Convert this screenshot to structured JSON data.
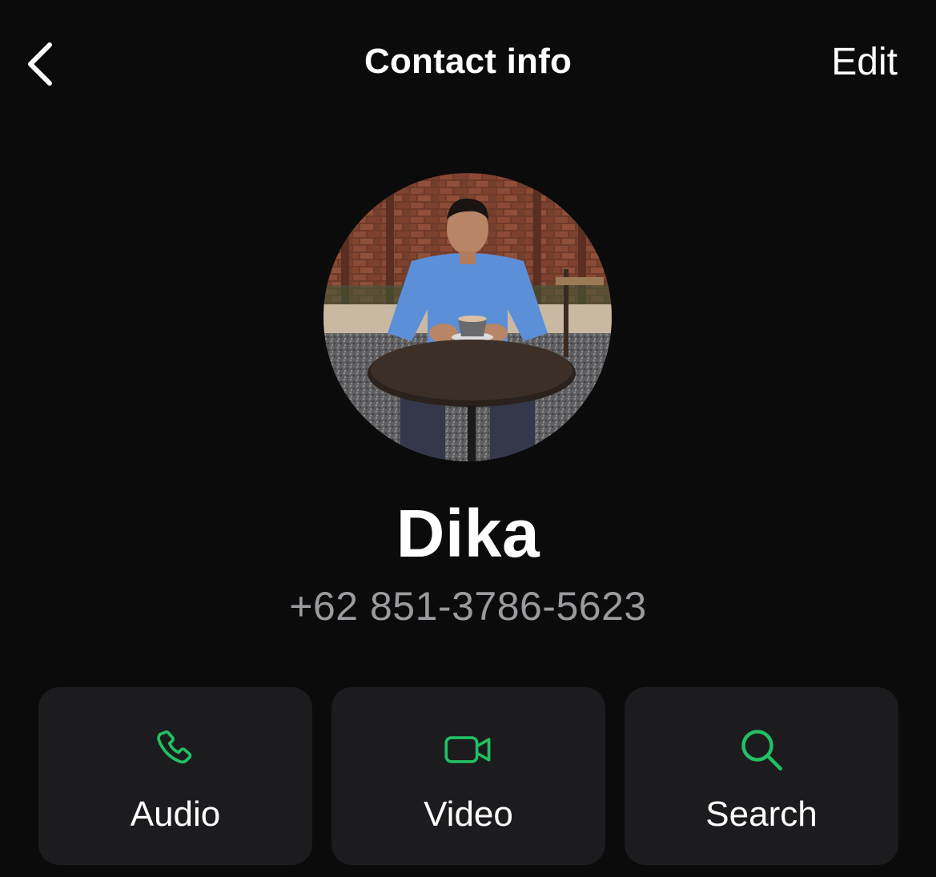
{
  "header": {
    "back_icon": "chevron-left-icon",
    "title": "Contact info",
    "edit_label": "Edit"
  },
  "contact": {
    "name": "Dika",
    "phone": "+62 851-3786-5623",
    "avatar_alt": "Profile photo"
  },
  "actions": [
    {
      "label": "Audio",
      "icon": "phone-icon"
    },
    {
      "label": "Video",
      "icon": "video-camera-icon"
    },
    {
      "label": "Search",
      "icon": "search-icon"
    }
  ],
  "colors": {
    "background": "#0b0b0b",
    "card": "#1c1c1e",
    "accent": "#21c063",
    "secondary_text": "#9b9b9f"
  }
}
